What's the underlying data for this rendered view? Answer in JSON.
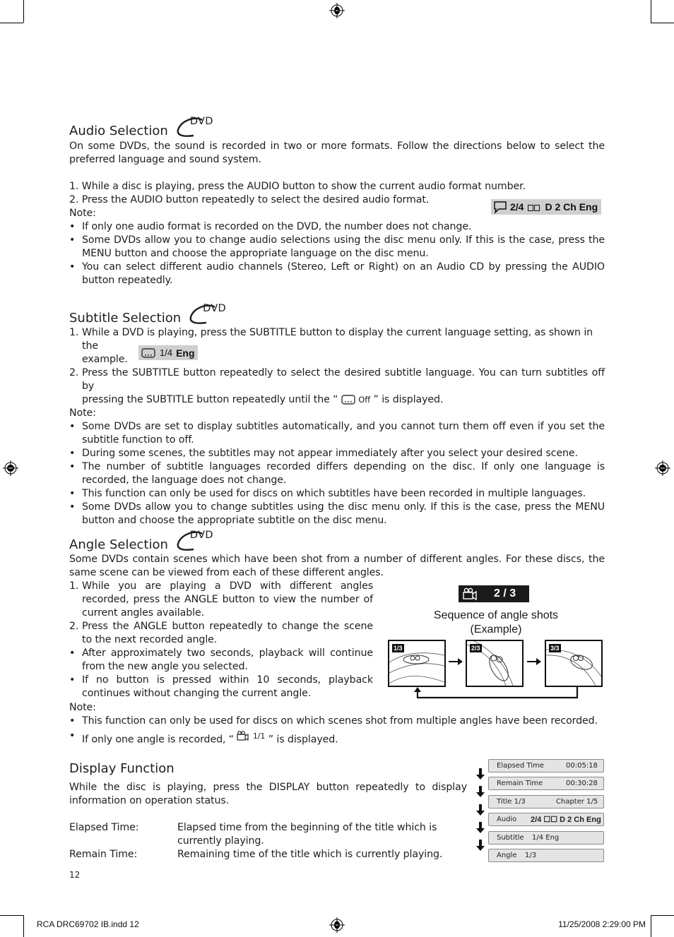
{
  "sections": {
    "audio": {
      "title": "Audio Selection",
      "badge": "DVD",
      "intro": "On some DVDs, the sound is recorded in two or more formats. Follow the directions below to select the preferred language and sound system.",
      "steps": [
        {
          "num": "1.",
          "text": "While a disc is playing, press the AUDIO button to show the current audio format number."
        },
        {
          "num": "2.",
          "text": "Press the AUDIO button repeatedly to select the desired audio format."
        }
      ],
      "note_label": "Note:",
      "notes": [
        "If only one audio format is recorded on the DVD, the number does not change.",
        "Some DVDs allow you to change audio selections using the disc menu only. If this is the case, press the MENU button and choose the appropriate language on the disc menu.",
        "You can select different audio channels (Stereo, Left or Right) on an Audio CD by pressing the AUDIO button repeatedly."
      ],
      "osd": {
        "icon": "speech-bubble-icon",
        "track": "2/4",
        "format": "D 2 Ch Eng"
      }
    },
    "subtitle": {
      "title": "Subtitle Selection",
      "badge": "DVD",
      "step1_num": "1.",
      "step1_text": "While a DVD is playing, press the SUBTITLE button to display the current language setting, as shown in the",
      "step1_tail": "example.",
      "osd": {
        "icon": "subtitle-icon",
        "track": "1/4",
        "lang": "Eng"
      },
      "step2_num": "2.",
      "step2_text_a": "Press the SUBTITLE button repeatedly to select the desired subtitle language. You can turn subtitles off by",
      "step2_text_b": "pressing the SUBTITLE button repeatedly until the “",
      "step2_off": "Off",
      "step2_text_c": "” is displayed.",
      "note_label": "Note:",
      "notes": [
        "Some DVDs are set to display subtitles automatically, and you cannot turn them off even if you set the subtitle function to off.",
        "During some scenes, the subtitles may not appear immediately after you select your desired scene.",
        "The number of subtitle languages recorded differs depending on the disc. If only one language is recorded, the language does not change.",
        "This function can only be used for discs on which subtitles have been recorded in multiple languages.",
        "Some DVDs allow you to change subtitles using the disc menu only. If this is the case, press the MENU button and choose the appropriate subtitle on the disc menu."
      ]
    },
    "angle": {
      "title": "Angle Selection",
      "badge": "DVD",
      "intro": "Some DVDs contain scenes which have been shot from a number of different angles. For these discs, the same scene can be viewed from each of these different angles.",
      "steps": [
        {
          "num": "1.",
          "text": "While you are playing a DVD with different angles recorded, press the ANGLE button to view the number of current angles available."
        },
        {
          "num": "2.",
          "text": "Press the ANGLE button repeatedly to change the scene to the next recorded angle."
        }
      ],
      "bullets": [
        "After approximately two seconds, playback will continue from the new angle you selected.",
        "If no button is pressed within 10 seconds, playback continues without changing the current angle."
      ],
      "note_label": "Note:",
      "notes": [
        "This function can only be used for discs on which scenes shot from multiple angles have been recorded."
      ],
      "note2_a": "If only one angle is recorded, “",
      "note2_value": "1/1",
      "note2_b": "” is displayed.",
      "osd": {
        "icon": "camera-icon",
        "value": "2 / 3"
      },
      "figure_caption_1": "Sequence of angle shots",
      "figure_caption_2": "(Example)",
      "shots": [
        "1/3",
        "2/3",
        "3/3"
      ]
    },
    "display": {
      "title": "Display Function",
      "intro": "While the disc is playing, press the DISPLAY button repeatedly to display information on operation status.",
      "definitions": [
        {
          "term": "Elapsed Time:",
          "desc_1": "Elapsed time from the beginning of the title which is",
          "desc_2": "currently playing."
        },
        {
          "term": "Remain Time:",
          "desc_1": "Remaining time of the title which is currently playing.",
          "desc_2": ""
        }
      ],
      "info_screens": [
        {
          "label": "Elapsed  Time",
          "value": "00:05:18"
        },
        {
          "label": "Remain  Time",
          "value": "00:30:28"
        },
        {
          "label": "Title  1/3",
          "value": "Chapter  1/5"
        },
        {
          "label": "Audio",
          "value": "2/4 ☐☐ D 2 Ch Eng"
        },
        {
          "label": "Subtitle",
          "value": "1/4 Eng"
        },
        {
          "label": "Angle",
          "value": "1/3"
        }
      ]
    }
  },
  "page_number": "12",
  "footer": {
    "left": "RCA DRC69702 IB.indd   12",
    "right": "11/25/2008   2:29:00 PM"
  }
}
